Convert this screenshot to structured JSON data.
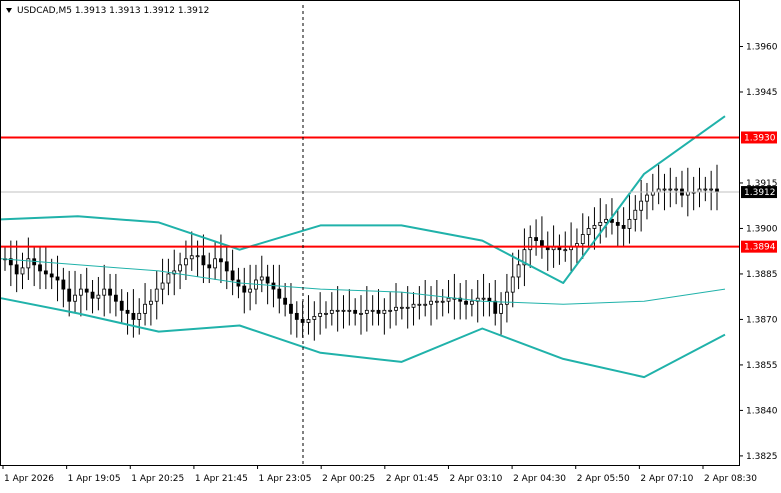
{
  "header": {
    "menu_icon": "triangle-down-icon",
    "symbol_info": "USDCAD,M5 1.3913 1.3913 1.3912 1.3912"
  },
  "colors": {
    "background": "#ffffff",
    "frame": "#000000",
    "grid": "#c0c0c0",
    "candle": "#000000",
    "bollinger": "#20b2aa",
    "level": "#ff0000",
    "level_label_text": "#ffffff",
    "bid_line": "#c0c0c0",
    "bid_label_bg": "#000000",
    "bid_label_text": "#ffffff"
  },
  "chart_data": {
    "type": "candlestick",
    "symbol": "USDCAD",
    "timeframe": "M5",
    "ohlc_last": {
      "open": 1.3913,
      "high": 1.3913,
      "low": 1.3912,
      "close": 1.3912
    },
    "ylim": [
      1.3822,
      1.3975
    ],
    "y_ticks": [
      "1.3960",
      "1.3945",
      "1.3915",
      "1.3900",
      "1.3885",
      "1.3870",
      "1.3855",
      "1.3840",
      "1.3825"
    ],
    "x_ticks": [
      "1 Apr 2026",
      "1 Apr 19:05",
      "1 Apr 20:25",
      "1 Apr 21:45",
      "1 Apr 23:05",
      "2 Apr 00:25",
      "2 Apr 01:45",
      "2 Apr 03:10",
      "2 Apr 04:30",
      "2 Apr 05:50",
      "2 Apr 07:10",
      "2 Apr 08:30"
    ],
    "levels": [
      {
        "price": 1.393,
        "label": "1.3930"
      },
      {
        "price": 1.3894,
        "label": "1.3894"
      }
    ],
    "bid": {
      "price": 1.3912,
      "label": "1.3912"
    },
    "candle_closes": [
      1.389,
      1.3888,
      1.3885,
      1.3887,
      1.389,
      1.3888,
      1.3886,
      1.3885,
      1.3884,
      1.3883,
      1.388,
      1.3876,
      1.3878,
      1.388,
      1.3879,
      1.3877,
      1.3878,
      1.388,
      1.3878,
      1.3876,
      1.3873,
      1.3872,
      1.387,
      1.3872,
      1.3875,
      1.3876,
      1.388,
      1.3882,
      1.3885,
      1.3886,
      1.3888,
      1.389,
      1.3891,
      1.3891,
      1.3888,
      1.3887,
      1.389,
      1.3889,
      1.3886,
      1.3883,
      1.3881,
      1.3879,
      1.388,
      1.3883,
      1.3884,
      1.3882,
      1.388,
      1.3877,
      1.3875,
      1.3872,
      1.387,
      1.3869,
      1.387,
      1.3871,
      1.3872,
      1.3872,
      1.3873,
      1.3873,
      1.3873,
      1.3873,
      1.3872,
      1.3872,
      1.3873,
      1.3873,
      1.3872,
      1.3873,
      1.3873,
      1.3874,
      1.3874,
      1.3874,
      1.3875,
      1.3875,
      1.3875,
      1.3876,
      1.3876,
      1.3876,
      1.3877,
      1.3877,
      1.3876,
      1.3875,
      1.3876,
      1.3877,
      1.3877,
      1.3876,
      1.3872,
      1.3875,
      1.3879,
      1.3884,
      1.3888,
      1.3893,
      1.3897,
      1.3896,
      1.3894,
      1.3893,
      1.3894,
      1.3893,
      1.3893,
      1.3894,
      1.3895,
      1.3898,
      1.39,
      1.3901,
      1.3902,
      1.3903,
      1.3902,
      1.3901,
      1.39,
      1.3903,
      1.3906,
      1.3909,
      1.3911,
      1.3912,
      1.3913,
      1.3913,
      1.3913,
      1.3913,
      1.3911,
      1.3912,
      1.3912,
      1.3913,
      1.3913,
      1.3913,
      1.3912
    ],
    "bollinger": {
      "period": 20,
      "middle": [
        [
          1,
          1.389
        ],
        [
          20,
          1.3888
        ],
        [
          40,
          1.3886
        ],
        [
          60,
          1.3882
        ],
        [
          80,
          1.388
        ],
        [
          100,
          1.3879
        ],
        [
          120,
          1.3876
        ],
        [
          140,
          1.3875
        ],
        [
          160,
          1.3876
        ],
        [
          180,
          1.388
        ]
      ],
      "upper": [
        [
          1,
          1.3903
        ],
        [
          20,
          1.3904
        ],
        [
          40,
          1.3902
        ],
        [
          60,
          1.3893
        ],
        [
          80,
          1.3901
        ],
        [
          100,
          1.3901
        ],
        [
          120,
          1.3896
        ],
        [
          140,
          1.3882
        ],
        [
          160,
          1.3918
        ],
        [
          180,
          1.3937
        ]
      ],
      "lower": [
        [
          1,
          1.3877
        ],
        [
          20,
          1.3872
        ],
        [
          40,
          1.3866
        ],
        [
          60,
          1.3868
        ],
        [
          80,
          1.3859
        ],
        [
          100,
          1.3856
        ],
        [
          120,
          1.3867
        ],
        [
          140,
          1.3857
        ],
        [
          160,
          1.3851
        ],
        [
          180,
          1.3865
        ]
      ]
    },
    "grid": false
  }
}
